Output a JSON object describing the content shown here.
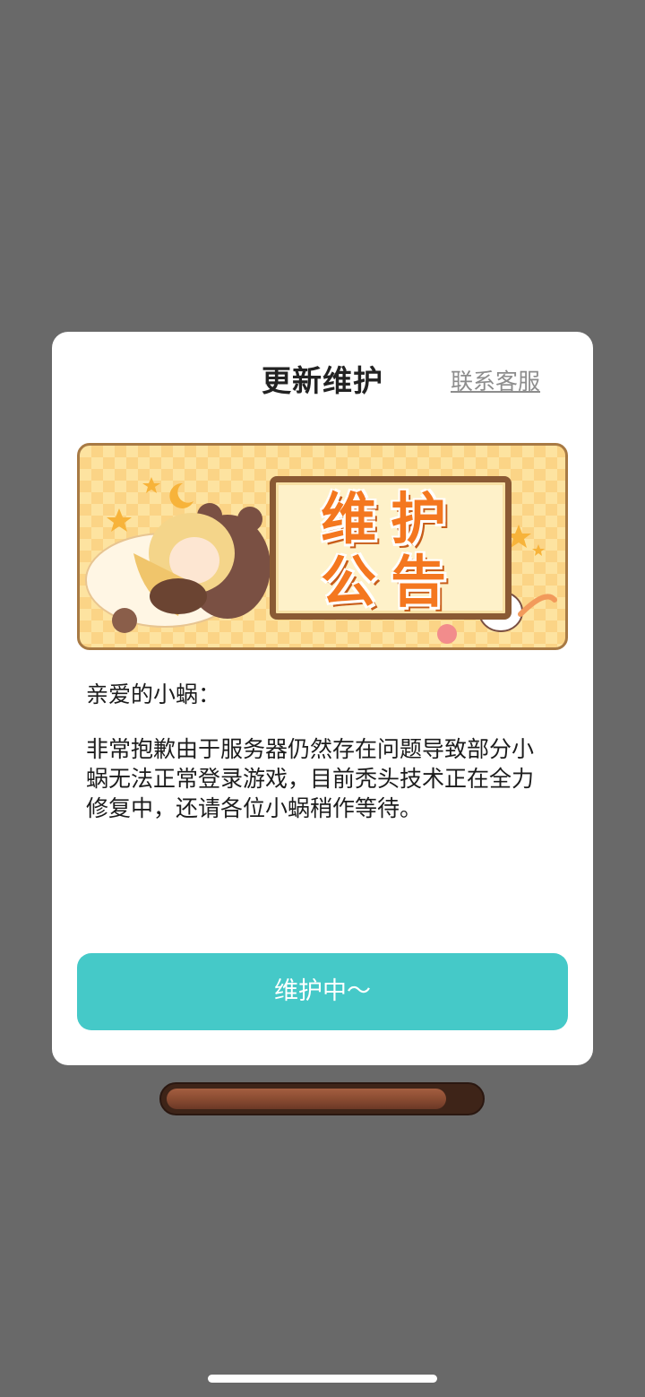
{
  "dialog": {
    "title": "更新维护",
    "support_link": "联系客服",
    "banner": {
      "line1": "维护",
      "line2": "公告"
    },
    "greeting": "亲爱的小蜗：",
    "message": "非常抱歉由于服务器仍然存在问题导致部分小蜗无法正常登录游戏，目前秃头技术正在全力修复中，还请各位小蜗稍作等待。",
    "button_label": "维护中～"
  },
  "loading_bar": {
    "progress": 0.9
  },
  "colors": {
    "overlay": "#696969",
    "accent_button": "#45c9c8",
    "banner_text": "#f4771f",
    "progress_fill": "#8a4c32"
  }
}
